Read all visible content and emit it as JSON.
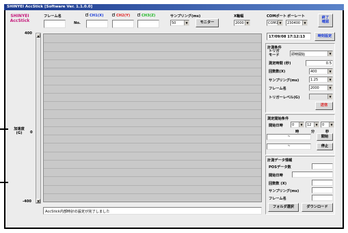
{
  "window": {
    "title": "SHINYEI AccStick [Software Ver. 1.1.0.0]"
  },
  "brand": {
    "line1": "SHINYEI",
    "line2": "AccStick"
  },
  "top": {
    "frame_name_label": "フレーム名",
    "no_label": "No.",
    "channels": [
      {
        "label": "CH1(X)",
        "checked": true,
        "color": "#1a3bd6"
      },
      {
        "label": "CH2(Y)",
        "checked": true,
        "color": "#e01f1f"
      },
      {
        "label": "CH3(Z)",
        "checked": true,
        "color": "#19b61f"
      }
    ],
    "sampling_label": "サンプリング(ms)",
    "sampling_value": "50",
    "monitor_button": "モニター",
    "x_axis_label": "X軸幅",
    "x_axis_value": "2000",
    "com_port_label": "COMポート",
    "com_port_value": "COM1",
    "baud_rate_label": "ボーレート",
    "baud_rate_value": "230400",
    "end_button": "終了\n確認"
  },
  "axis": {
    "y_label_line1": "加速度",
    "y_label_line2": "(G)",
    "y_max": "400",
    "y_mid": "0",
    "y_min": "-400"
  },
  "status": {
    "message": "AccStick内部時計の設定が完了しました"
  },
  "clock": {
    "datetime": "17/09/08 17:12:13",
    "set_button": "時刻設定"
  },
  "measure": {
    "title": "計測条件",
    "trigger_mode_label": "トリガ\nモード",
    "trigger_mode_value": "即時開始",
    "duration_label": "測定時間 (秒)",
    "duration_value": "0.5",
    "points_label": "回数数(X)",
    "points_value": "400",
    "sampling_label": "サンプリング(ms)",
    "sampling_value": "1.25",
    "frame_name_label": "フレーム名",
    "frame_name_value": "2000",
    "trigger_level_label": "トリガーレベル(G)",
    "trigger_level_value": "",
    "send_button": "送信"
  },
  "start": {
    "title": "測定開始条件",
    "start_time_label": "開始日時",
    "hour": "0",
    "minute": "12",
    "second": "0",
    "unit_h": "時",
    "unit_m": "分",
    "unit_s": "秒",
    "start_button": "開始",
    "stop_button": "停止",
    "range_sep": "~"
  },
  "data_info": {
    "title": "計測データ情報",
    "data_count_label": "POSデータ数",
    "start_time_label": "開始日時",
    "points_label": "回数数 (X)",
    "sampling_label": "サンプリング(ms)",
    "frame_name_label": "フレーム名",
    "folder_button": "フォルダ選択",
    "download_button": "ダウンロード"
  }
}
